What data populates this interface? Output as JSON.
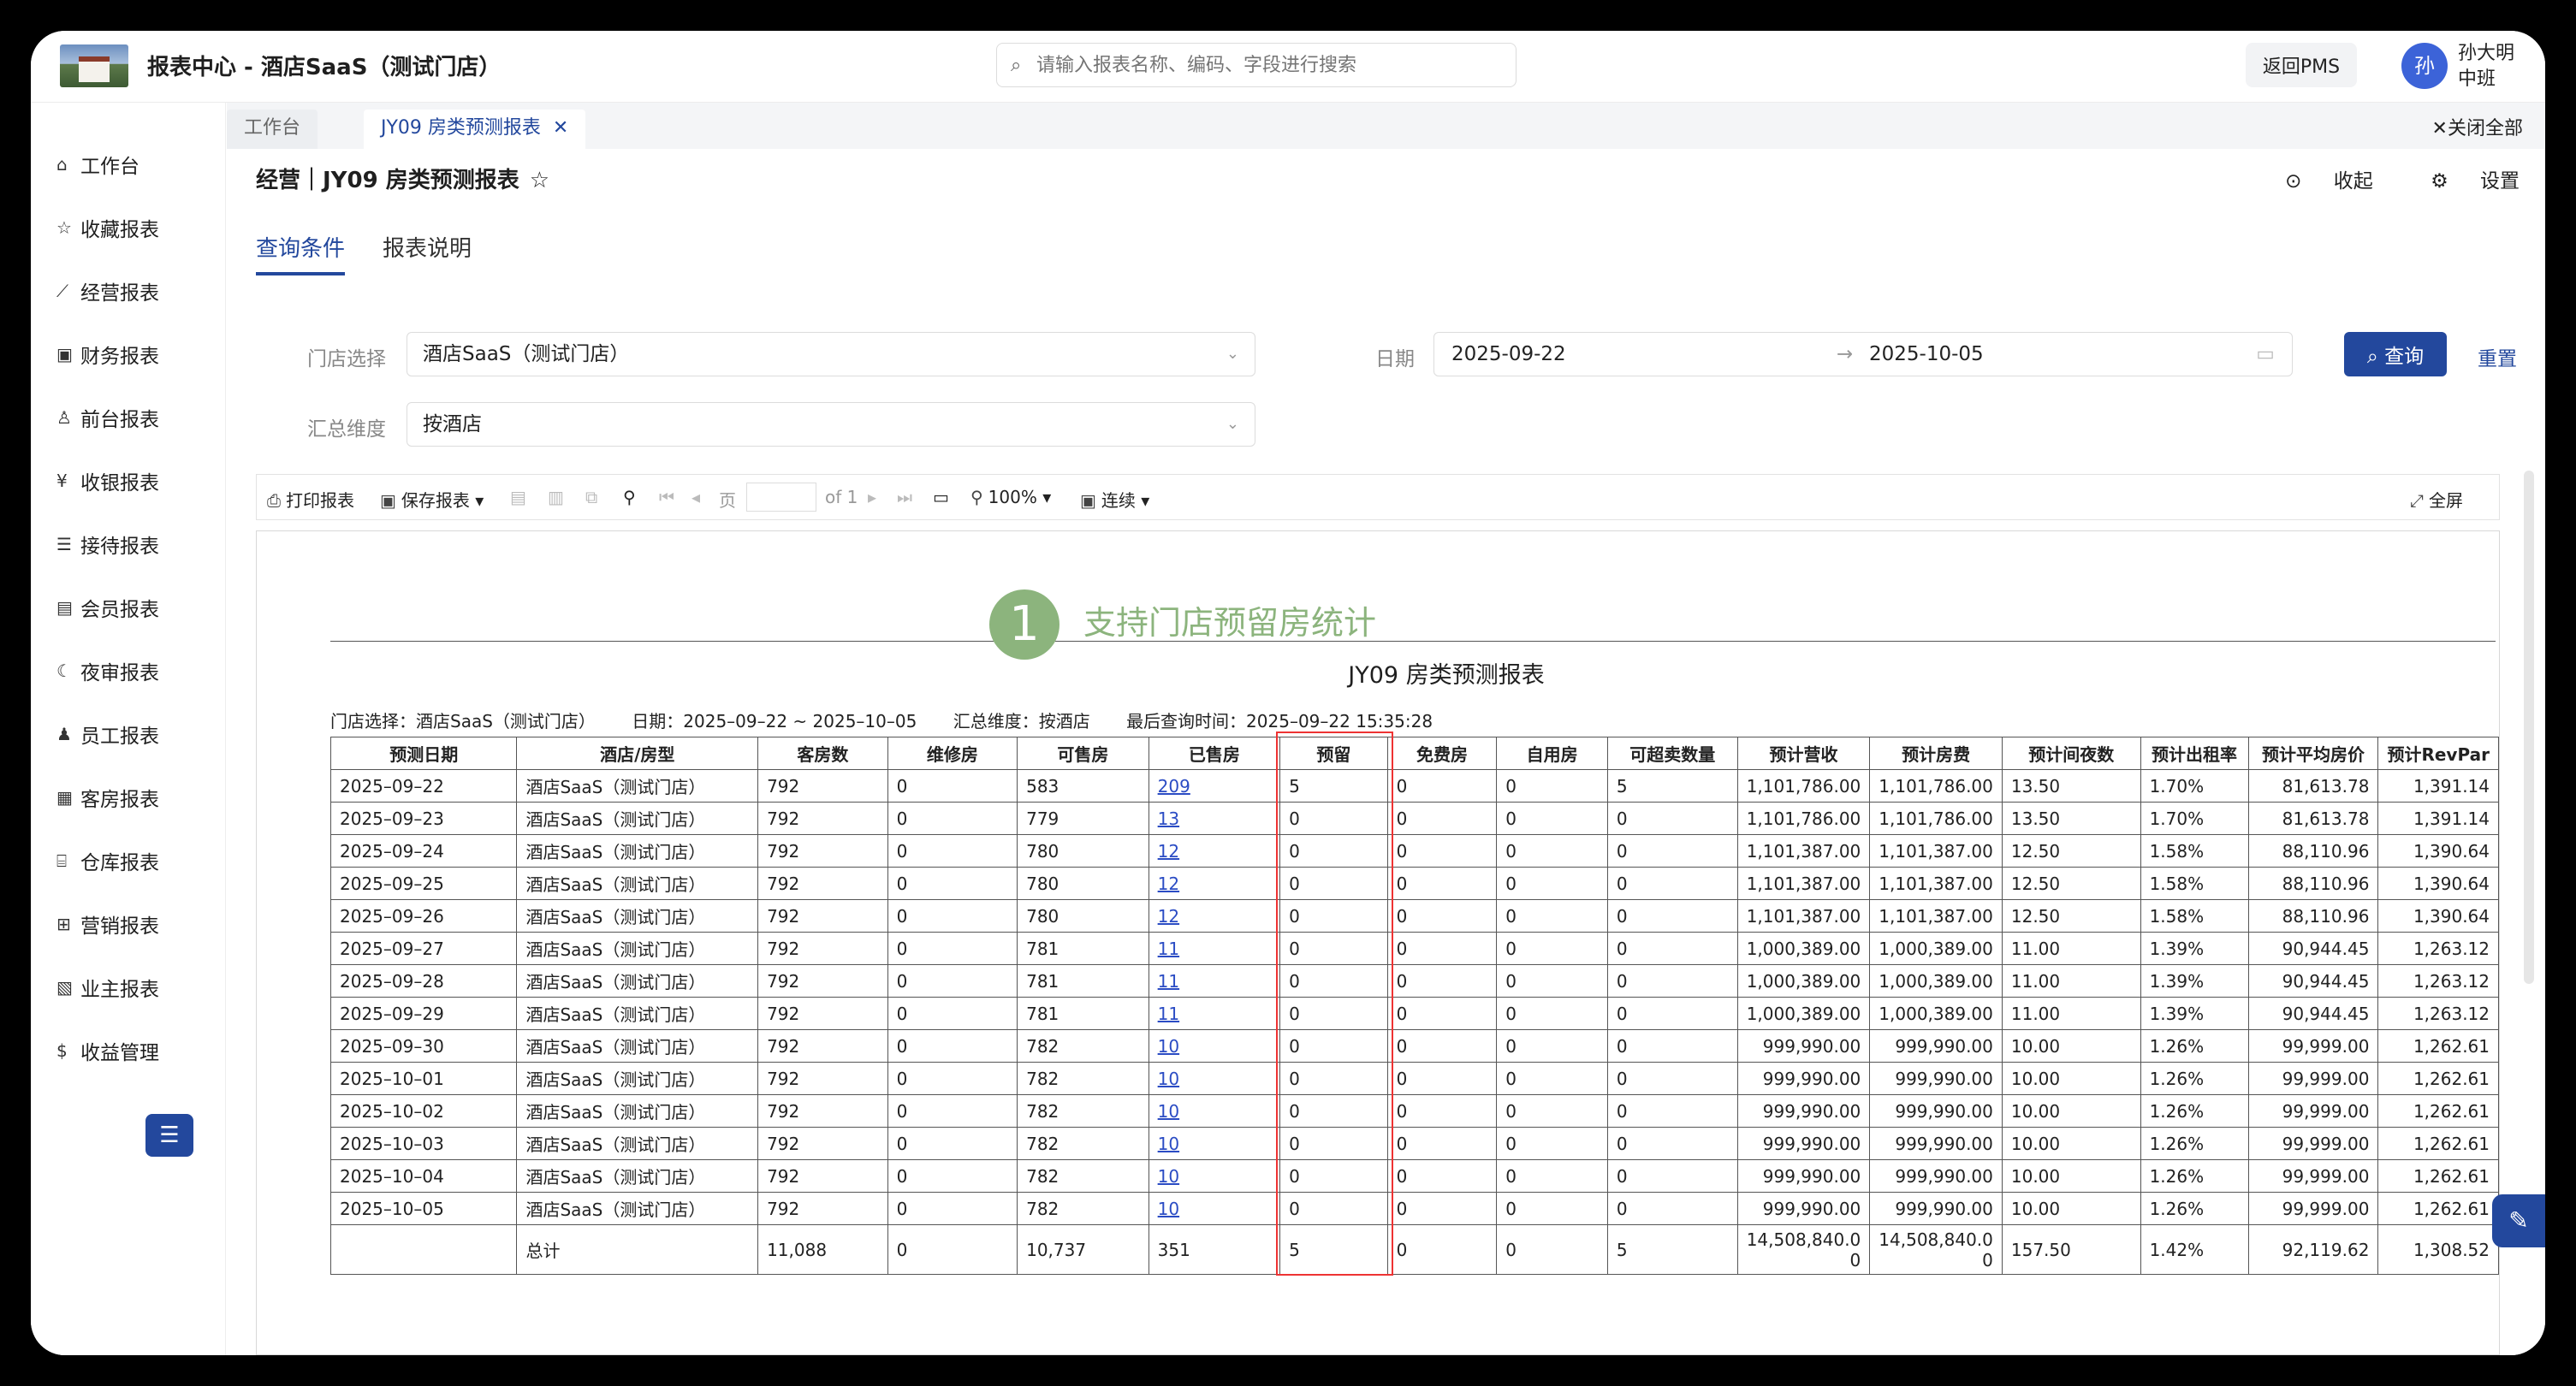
{
  "header": {
    "title": "报表中心 - 酒店SaaS（测试门店）",
    "search_placeholder": "请输入报表名称、编码、字段进行搜索",
    "back_label": "返回PMS",
    "avatar_char": "孙",
    "user_name": "孙大明",
    "user_shift": "中班"
  },
  "sidebar": {
    "items": [
      {
        "label": "工作台",
        "icon": "home-icon"
      },
      {
        "label": "收藏报表",
        "icon": "star-icon"
      },
      {
        "label": "经营报表",
        "icon": "chart-icon"
      },
      {
        "label": "财务报表",
        "icon": "finance-icon"
      },
      {
        "label": "前台报表",
        "icon": "person-icon"
      },
      {
        "label": "收银报表",
        "icon": "yen-icon"
      },
      {
        "label": "接待报表",
        "icon": "document-icon"
      },
      {
        "label": "会员报表",
        "icon": "member-icon"
      },
      {
        "label": "夜审报表",
        "icon": "moon-icon"
      },
      {
        "label": "员工报表",
        "icon": "staff-icon"
      },
      {
        "label": "客房报表",
        "icon": "room-icon"
      },
      {
        "label": "仓库报表",
        "icon": "warehouse-icon"
      },
      {
        "label": "营销报表",
        "icon": "gift-icon"
      },
      {
        "label": "业主报表",
        "icon": "owner-icon"
      },
      {
        "label": "收益管理",
        "icon": "revenue-icon"
      }
    ]
  },
  "tabs": [
    {
      "label": "工作台"
    },
    {
      "label": "JY09 房类预测报表"
    }
  ],
  "close_all_label": "关闭全部",
  "page": {
    "title": "经营｜JY09 房类预测报表",
    "collapse_label": "收起",
    "settings_label": "设置"
  },
  "query_tabs": [
    "查询条件",
    "报表说明"
  ],
  "filters": {
    "store_label": "门店选择",
    "store_value": "酒店SaaS（测试门店）",
    "date_label": "日期",
    "date_start": "2025-09-22",
    "date_end": "2025-10-05",
    "dim_label": "汇总维度",
    "dim_value": "按酒店",
    "query_label": "查询",
    "reset_label": "重置"
  },
  "toolbar": {
    "print_label": "打印报表",
    "save_label": "保存报表",
    "page_label": "页",
    "of_label": "of 1",
    "zoom": "100%",
    "mode": "连续",
    "fullscreen_label": "全屏"
  },
  "annotation": {
    "number": "1",
    "text": "支持门店预留房统计"
  },
  "report": {
    "title": "JY09 房类预测报表",
    "meta_store": "门店选择：酒店SaaS（测试门店）",
    "meta_date": "日期：2025–09–22 ~ 2025–10–05",
    "meta_dim": "汇总维度：按酒店",
    "meta_time": "最后查询时间：2025–09–22 15:35:28",
    "columns": [
      "预测日期",
      "酒店/房型",
      "客房数",
      "维修房",
      "可售房",
      "已售房",
      "预留",
      "免费房",
      "自用房",
      "可超卖数量",
      "预计营收",
      "预计房费",
      "预计间夜数",
      "预计出租率",
      "预计平均房价",
      "预计RevPar"
    ],
    "rows": [
      [
        "2025–09–22",
        "酒店SaaS（测试门店）",
        "792",
        "0",
        "583",
        "209",
        "5",
        "0",
        "0",
        "5",
        "1,101,786.00",
        "1,101,786.00",
        "13.50",
        "1.70%",
        "81,613.78",
        "1,391.14"
      ],
      [
        "2025–09–23",
        "酒店SaaS（测试门店）",
        "792",
        "0",
        "779",
        "13",
        "0",
        "0",
        "0",
        "0",
        "1,101,786.00",
        "1,101,786.00",
        "13.50",
        "1.70%",
        "81,613.78",
        "1,391.14"
      ],
      [
        "2025–09–24",
        "酒店SaaS（测试门店）",
        "792",
        "0",
        "780",
        "12",
        "0",
        "0",
        "0",
        "0",
        "1,101,387.00",
        "1,101,387.00",
        "12.50",
        "1.58%",
        "88,110.96",
        "1,390.64"
      ],
      [
        "2025–09–25",
        "酒店SaaS（测试门店）",
        "792",
        "0",
        "780",
        "12",
        "0",
        "0",
        "0",
        "0",
        "1,101,387.00",
        "1,101,387.00",
        "12.50",
        "1.58%",
        "88,110.96",
        "1,390.64"
      ],
      [
        "2025–09–26",
        "酒店SaaS（测试门店）",
        "792",
        "0",
        "780",
        "12",
        "0",
        "0",
        "0",
        "0",
        "1,101,387.00",
        "1,101,387.00",
        "12.50",
        "1.58%",
        "88,110.96",
        "1,390.64"
      ],
      [
        "2025–09–27",
        "酒店SaaS（测试门店）",
        "792",
        "0",
        "781",
        "11",
        "0",
        "0",
        "0",
        "0",
        "1,000,389.00",
        "1,000,389.00",
        "11.00",
        "1.39%",
        "90,944.45",
        "1,263.12"
      ],
      [
        "2025–09–28",
        "酒店SaaS（测试门店）",
        "792",
        "0",
        "781",
        "11",
        "0",
        "0",
        "0",
        "0",
        "1,000,389.00",
        "1,000,389.00",
        "11.00",
        "1.39%",
        "90,944.45",
        "1,263.12"
      ],
      [
        "2025–09–29",
        "酒店SaaS（测试门店）",
        "792",
        "0",
        "781",
        "11",
        "0",
        "0",
        "0",
        "0",
        "1,000,389.00",
        "1,000,389.00",
        "11.00",
        "1.39%",
        "90,944.45",
        "1,263.12"
      ],
      [
        "2025–09–30",
        "酒店SaaS（测试门店）",
        "792",
        "0",
        "782",
        "10",
        "0",
        "0",
        "0",
        "0",
        "999,990.00",
        "999,990.00",
        "10.00",
        "1.26%",
        "99,999.00",
        "1,262.61"
      ],
      [
        "2025–10–01",
        "酒店SaaS（测试门店）",
        "792",
        "0",
        "782",
        "10",
        "0",
        "0",
        "0",
        "0",
        "999,990.00",
        "999,990.00",
        "10.00",
        "1.26%",
        "99,999.00",
        "1,262.61"
      ],
      [
        "2025–10–02",
        "酒店SaaS（测试门店）",
        "792",
        "0",
        "782",
        "10",
        "0",
        "0",
        "0",
        "0",
        "999,990.00",
        "999,990.00",
        "10.00",
        "1.26%",
        "99,999.00",
        "1,262.61"
      ],
      [
        "2025–10–03",
        "酒店SaaS（测试门店）",
        "792",
        "0",
        "782",
        "10",
        "0",
        "0",
        "0",
        "0",
        "999,990.00",
        "999,990.00",
        "10.00",
        "1.26%",
        "99,999.00",
        "1,262.61"
      ],
      [
        "2025–10–04",
        "酒店SaaS（测试门店）",
        "792",
        "0",
        "782",
        "10",
        "0",
        "0",
        "0",
        "0",
        "999,990.00",
        "999,990.00",
        "10.00",
        "1.26%",
        "99,999.00",
        "1,262.61"
      ],
      [
        "2025–10–05",
        "酒店SaaS（测试门店）",
        "792",
        "0",
        "782",
        "10",
        "0",
        "0",
        "0",
        "0",
        "999,990.00",
        "999,990.00",
        "10.00",
        "1.26%",
        "99,999.00",
        "1,262.61"
      ]
    ],
    "total": [
      "",
      "总计",
      "11,088",
      "0",
      "10,737",
      "351",
      "5",
      "0",
      "0",
      "5",
      "14,508,840.00",
      "14,508,840.00",
      "157.50",
      "1.42%",
      "92,119.62",
      "1,308.52"
    ]
  }
}
